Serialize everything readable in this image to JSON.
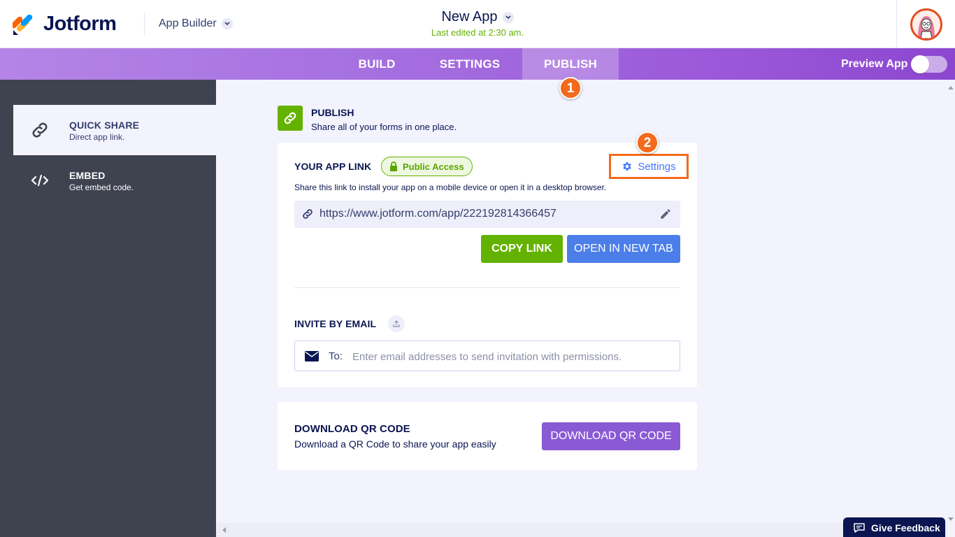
{
  "header": {
    "brand": "Jotform",
    "section": "App Builder",
    "app_title": "New App",
    "last_edited": "Last edited at 2:30 am."
  },
  "nav": {
    "tabs": [
      {
        "label": "BUILD",
        "active": false
      },
      {
        "label": "SETTINGS",
        "active": false
      },
      {
        "label": "PUBLISH",
        "active": true
      }
    ],
    "preview_label": "Preview App",
    "preview_on": false
  },
  "steps": {
    "one": "1",
    "two": "2"
  },
  "sidebar": {
    "items": [
      {
        "title": "QUICK SHARE",
        "subtitle": "Direct app link.",
        "icon": "link-icon",
        "active": true
      },
      {
        "title": "EMBED",
        "subtitle": "Get embed code.",
        "icon": "code-icon",
        "active": false
      }
    ]
  },
  "publish": {
    "title": "PUBLISH",
    "subtitle": "Share all of your forms in one place."
  },
  "app_link": {
    "title": "YOUR APP LINK",
    "badge": "Public Access",
    "settings_label": "Settings",
    "description": "Share this link to install your app on a mobile device or open it in a desktop browser.",
    "url": "https://www.jotform.com/app/222192814366457",
    "copy_label": "COPY LINK",
    "open_label": "OPEN IN NEW TAB"
  },
  "invite": {
    "title": "INVITE BY EMAIL",
    "to_label": "To:",
    "placeholder": "Enter email addresses to send invitation with permissions."
  },
  "qr": {
    "title": "DOWNLOAD QR CODE",
    "subtitle": "Download a QR Code to share your app easily",
    "button_label": "DOWNLOAD QR CODE"
  },
  "feedback": {
    "label": "Give Feedback"
  },
  "colors": {
    "accent_green": "#64b200",
    "accent_blue": "#4b7ee8",
    "accent_purple": "#8a5ad4",
    "step_orange": "#f26a1b",
    "sidebar_bg": "#3f4350"
  }
}
